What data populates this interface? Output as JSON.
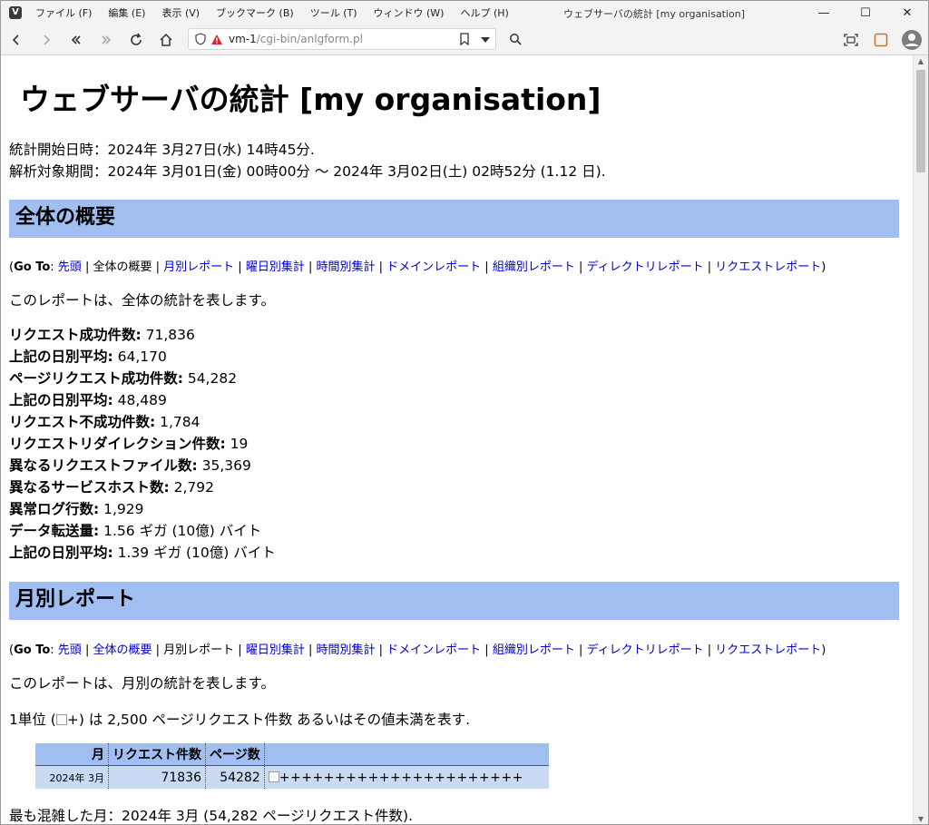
{
  "window": {
    "app_icon": "V",
    "title": "ウェブサーバの統計 [my organisation]",
    "menus": [
      "ファイル (F)",
      "編集 (E)",
      "表示 (V)",
      "ブックマーク (B)",
      "ツール (T)",
      "ウィンドウ (W)",
      "ヘルプ (H)"
    ],
    "controls": {
      "minimize": "—",
      "maximize": "☐",
      "close": "✕"
    }
  },
  "toolbar": {
    "url_host": "vm-1",
    "url_path": "/cgi-bin/anlgform.pl",
    "icons": [
      "back-icon",
      "forward-icon",
      "rewind-icon",
      "fast-forward-icon",
      "reload-icon",
      "home-icon",
      "shield-icon",
      "warning-icon",
      "bookmark-icon",
      "dropdown-icon",
      "search-icon",
      "capture-icon",
      "panel-icon",
      "profile-icon"
    ]
  },
  "page": {
    "heading": "ウェブサーバの統計 [my organisation]",
    "start_line": "統計開始日時：2024年 3月27日(水) 14時45分.",
    "period_line": "解析対象期間：2024年 3月01日(金) 00時00分 ～ 2024年 3月02日(土) 02時52分 (1.12 日).",
    "goto_label": "Go To",
    "goto_links": [
      "先頭",
      "全体の概要",
      "月別レポート",
      "曜日別集計",
      "時間別集計",
      "ドメインレポート",
      "組織別レポート",
      "ディレクトリレポート",
      "リクエストレポート"
    ],
    "summary": {
      "title": "全体の概要",
      "desc": "このレポートは、全体の統計を表します。",
      "stats": [
        {
          "label": "リクエスト成功件数:",
          "value": "71,836"
        },
        {
          "label": "上記の日別平均:",
          "value": "64,170"
        },
        {
          "label": "ページリクエスト成功件数:",
          "value": "54,282"
        },
        {
          "label": "上記の日別平均:",
          "value": "48,489"
        },
        {
          "label": "リクエスト不成功件数:",
          "value": "1,784"
        },
        {
          "label": "リクエストリダイレクション件数:",
          "value": "19"
        },
        {
          "label": "異なるリクエストファイル数:",
          "value": "35,369"
        },
        {
          "label": "異なるサービスホスト数:",
          "value": "2,792"
        },
        {
          "label": "異常ログ行数:",
          "value": "1,929"
        },
        {
          "label": "データ転送量:",
          "value": "1.56 ギガ (10億) バイト"
        },
        {
          "label": "上記の日別平均:",
          "value": "1.39 ギガ (10億) バイト"
        }
      ]
    },
    "monthly": {
      "title": "月別レポート",
      "desc": "このレポートは、月別の統計を表します。",
      "unit_prefix": "1単位 (",
      "unit_plus": "+",
      "unit_suffix": ") は 2,500 ページリクエスト件数 あるいはその値未満を表す.",
      "columns": [
        "月",
        "リクエスト件数",
        "ページ数"
      ],
      "rows": [
        {
          "month": "2024年  3月",
          "requests": "71836",
          "pages": "54282",
          "bar": "++++++++++++++++++++++"
        }
      ],
      "busiest": "最も混雑した月：2024年 3月 (54,282 ページリクエスト件数)."
    }
  }
}
